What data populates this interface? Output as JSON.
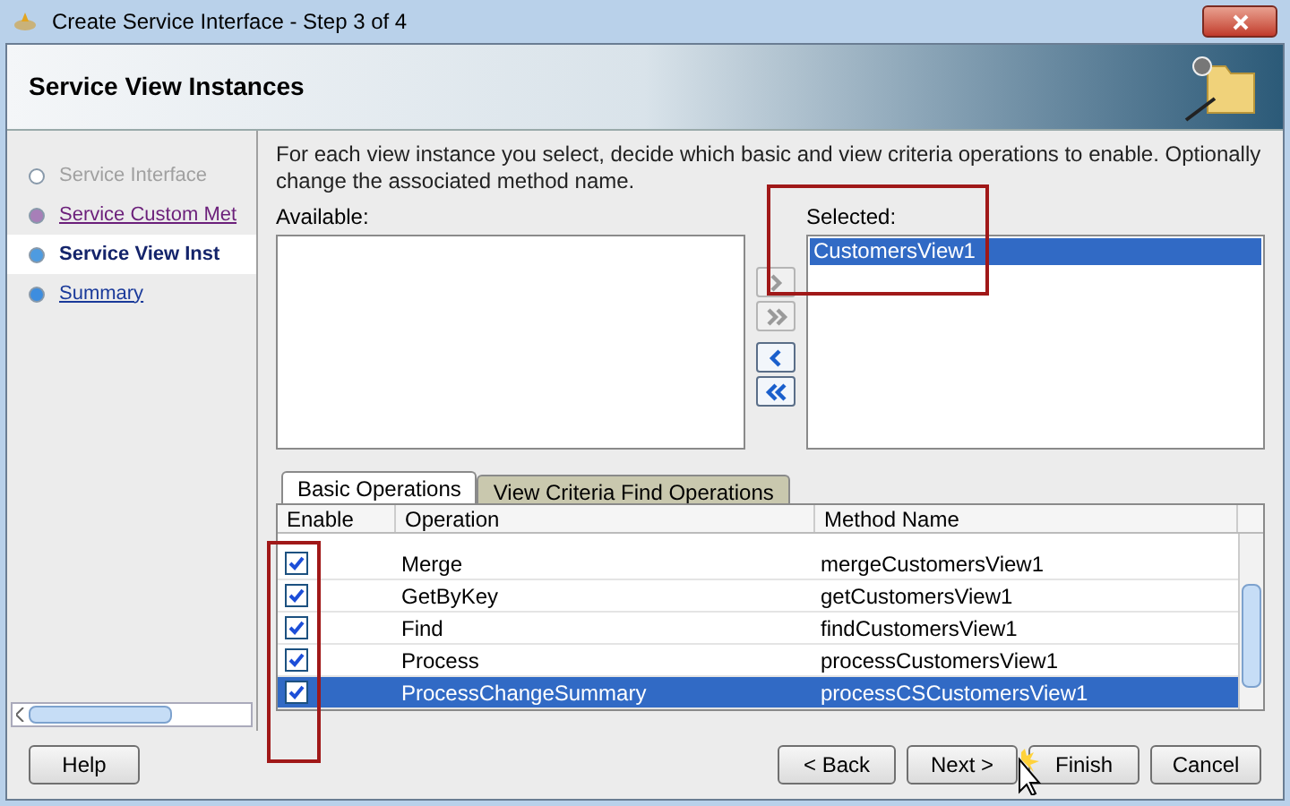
{
  "window": {
    "title": "Create Service Interface - Step 3 of 4"
  },
  "header": {
    "title": "Service View Instances"
  },
  "steps": [
    {
      "label": "Service Interface",
      "kind": "done"
    },
    {
      "label": "Service Custom Met",
      "kind": "visited"
    },
    {
      "label": "Service View Inst",
      "kind": "current"
    },
    {
      "label": "Summary",
      "kind": "pending"
    }
  ],
  "instructions": "For each view instance you select, decide which basic and view criteria operations to enable. Optionally change the associated method name.",
  "available": {
    "label": "Available:"
  },
  "selected": {
    "label": "Selected:",
    "items": [
      {
        "name": "CustomersView1",
        "selected": true
      }
    ]
  },
  "shuttle_buttons": [
    {
      "kind": "add",
      "enabled": false
    },
    {
      "kind": "add_all",
      "enabled": false
    },
    {
      "kind": "remove",
      "enabled": true
    },
    {
      "kind": "remove_all",
      "enabled": true
    }
  ],
  "tabs": [
    {
      "label": "Basic Operations",
      "selected": true
    },
    {
      "label": "View Criteria Find Operations",
      "selected": false
    }
  ],
  "table": {
    "columns": [
      "Enable",
      "Operation",
      "Method Name"
    ],
    "rows": [
      {
        "checked": true,
        "operation": "Merge",
        "method": "mergeCustomersView1",
        "selected": false
      },
      {
        "checked": true,
        "operation": "GetByKey",
        "method": "getCustomersView1",
        "selected": false
      },
      {
        "checked": true,
        "operation": "Find",
        "method": "findCustomersView1",
        "selected": false
      },
      {
        "checked": true,
        "operation": "Process",
        "method": "processCustomersView1",
        "selected": false
      },
      {
        "checked": true,
        "operation": "ProcessChangeSummary",
        "method": "processCSCustomersView1",
        "selected": true
      }
    ]
  },
  "buttons": {
    "help": "Help",
    "back": "< Back",
    "next": "Next >",
    "finish": "Finish",
    "cancel": "Cancel"
  }
}
